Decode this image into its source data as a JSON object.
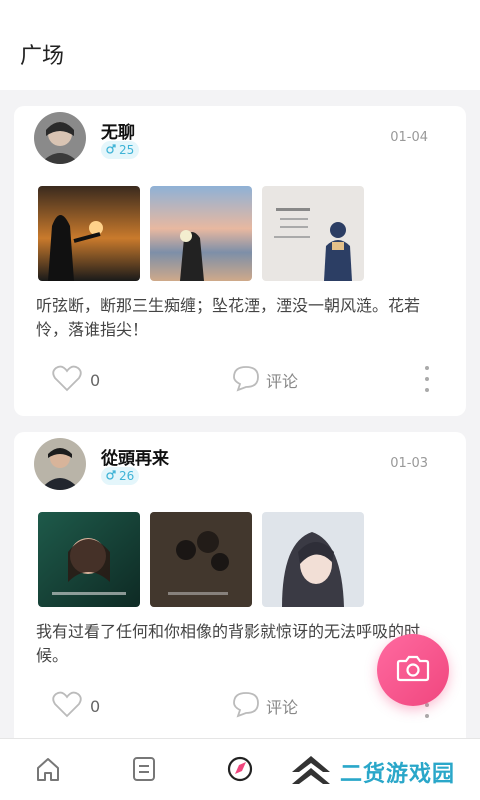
{
  "header": {
    "title": "广场"
  },
  "posts": [
    {
      "username": "无聊",
      "gender_icon": "male-icon",
      "age": "25",
      "date": "01-04",
      "text": "听弦断，断那三生痴缠；坠花湮，湮没一朝风涟。花若怜，落谁指尖！",
      "likes": "0",
      "comment_label": "评论",
      "photos": [
        "photo-silhouette-sunset",
        "photo-girl-beach-flowers",
        "photo-illustration-boy-quote"
      ]
    },
    {
      "username": "從頭再来",
      "gender_icon": "male-icon",
      "age": "26",
      "date": "01-03",
      "text": "我有过看了任何和你相像的背影就惊讶的无法呼吸的时候。",
      "likes": "0",
      "comment_label": "评论",
      "photos": [
        "photo-woman-film-still",
        "photo-dark-roses",
        "photo-anime-girl"
      ]
    }
  ],
  "tabbar": {
    "items": [
      "home-icon",
      "list-icon",
      "square-icon",
      "messages-icon"
    ]
  },
  "watermark": {
    "text": "二货游戏园"
  },
  "colors": {
    "accent": "#f0467e",
    "badge": "#3fb3d6",
    "watermark": "#2aa7c9"
  }
}
